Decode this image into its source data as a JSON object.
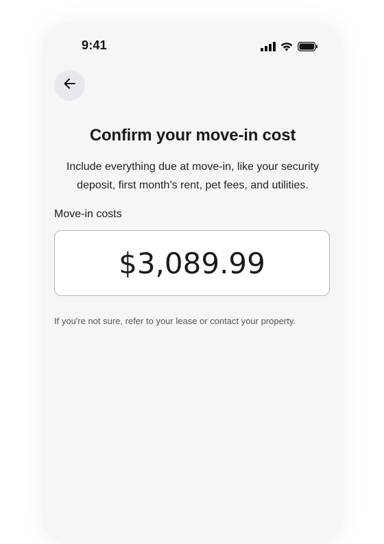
{
  "status_bar": {
    "time": "9:41",
    "icons": [
      "cellular-signal-icon",
      "wifi-icon",
      "battery-icon"
    ]
  },
  "back_button": {
    "icon": "arrow-left-icon"
  },
  "page": {
    "title": "Confirm your move-in cost",
    "subtitle_line1": "Include everything due at move-in, like your security",
    "subtitle_line2": "deposit, first month’s rent, pet fees, and utilities.",
    "field_label": "Move-in costs",
    "amount_value": "$3,089.99",
    "hint": "If you're not sure, refer to your lease or contact your property."
  },
  "colors": {
    "screen_background": "#f6f6f6",
    "back_button_background": "#e9e8ee",
    "input_border": "#b5b5b5",
    "text_primary": "#1a1a1a",
    "text_secondary": "#555555"
  }
}
